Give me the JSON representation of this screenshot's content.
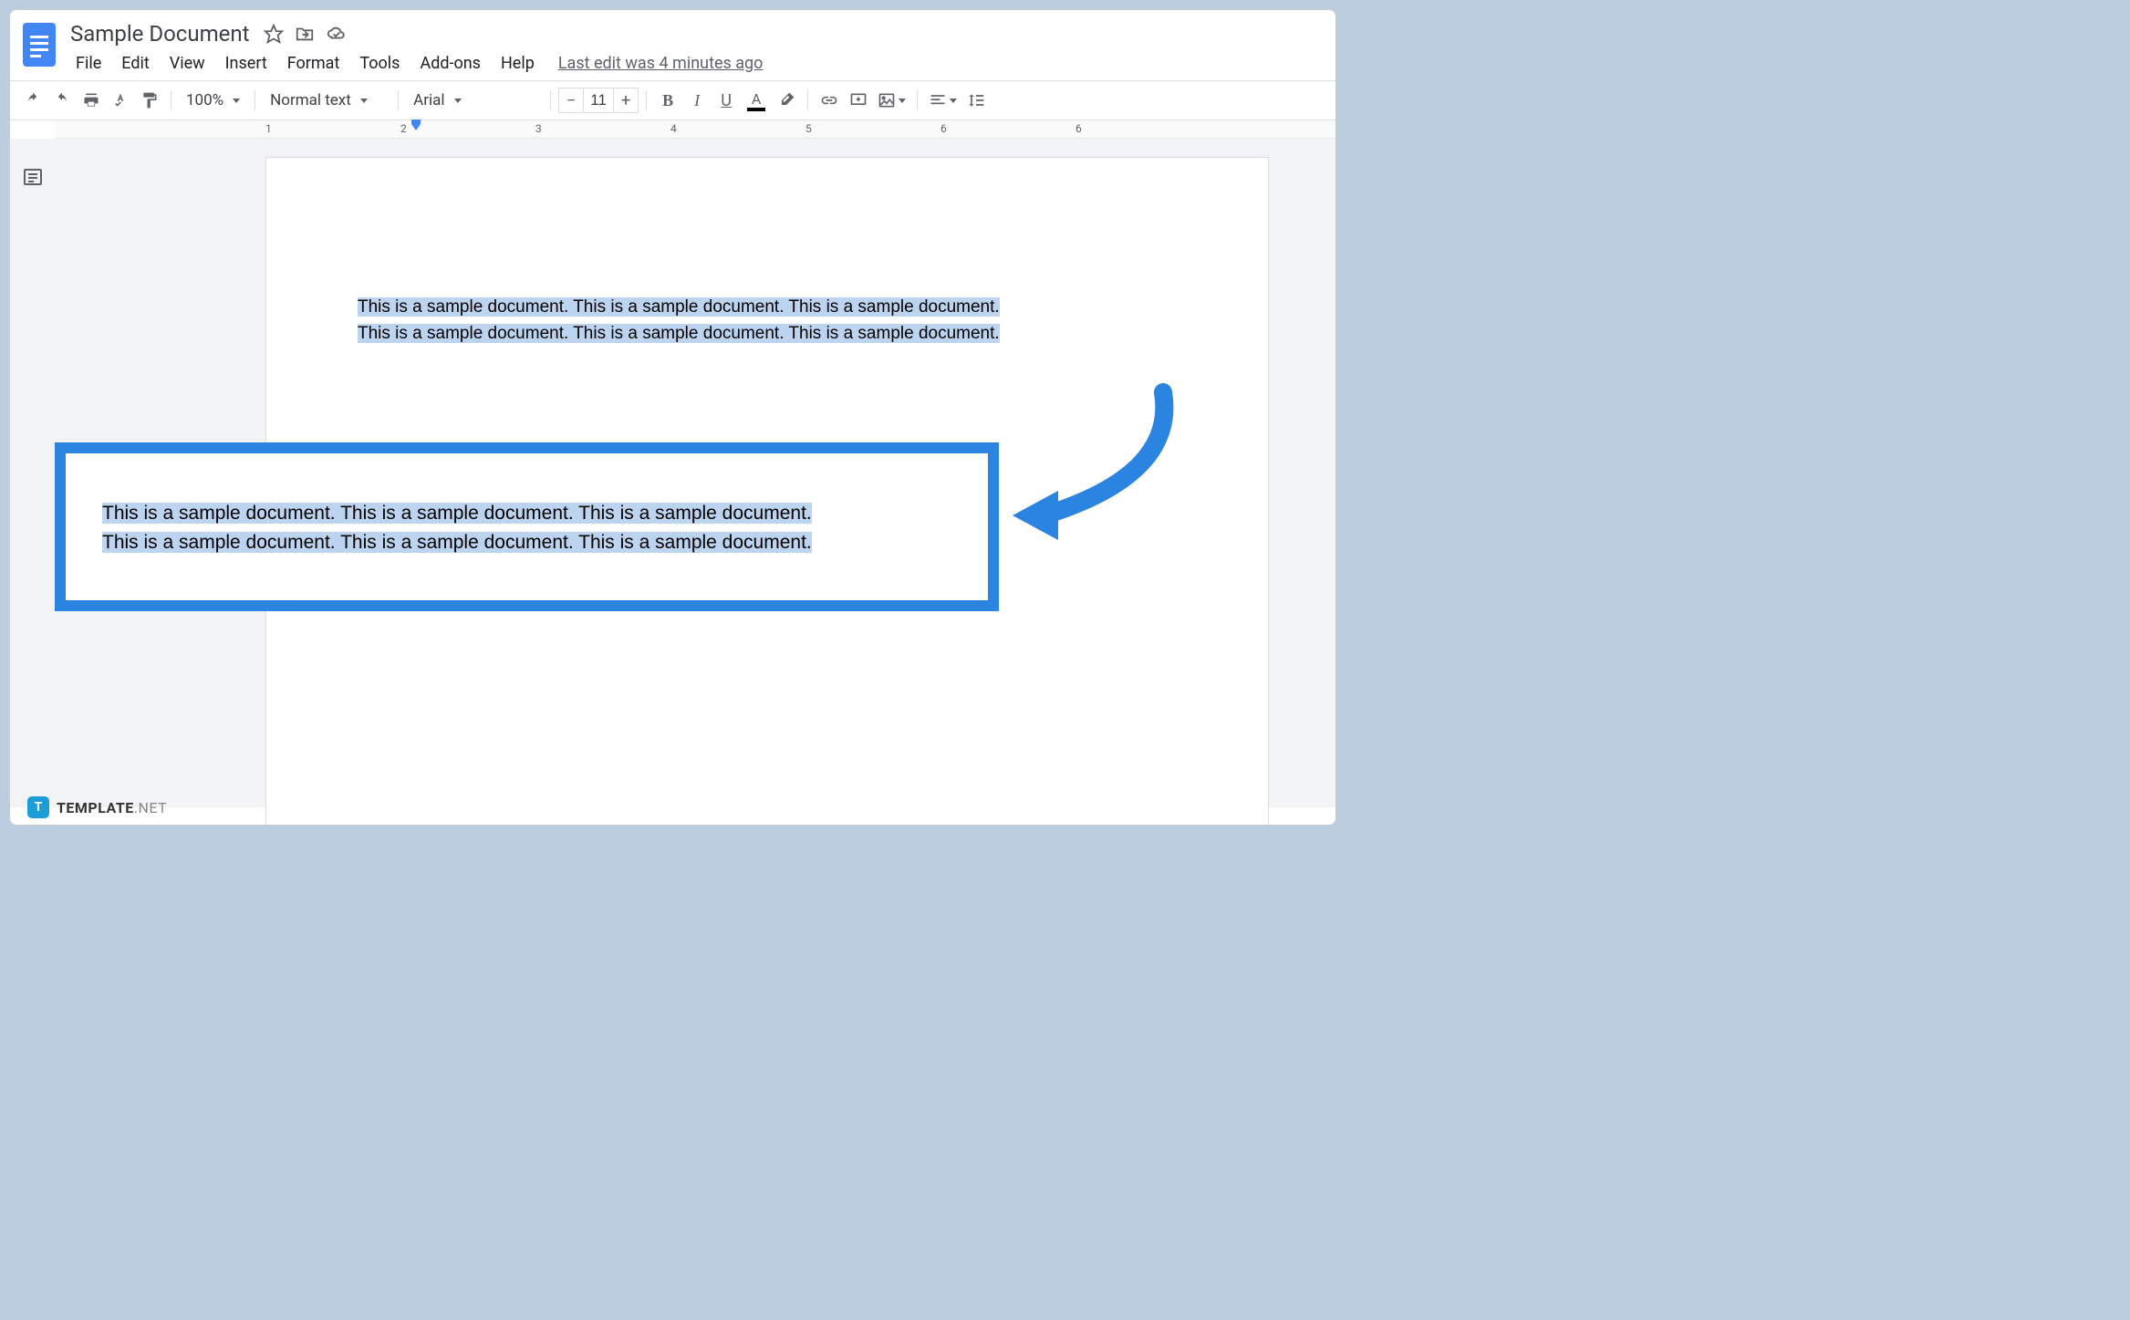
{
  "header": {
    "title": "Sample Document",
    "last_edit": "Last edit was 4 minutes ago"
  },
  "menubar": {
    "items": [
      "File",
      "Edit",
      "View",
      "Insert",
      "Format",
      "Tools",
      "Add-ons",
      "Help"
    ]
  },
  "toolbar": {
    "zoom": "100%",
    "style": "Normal text",
    "font": "Arial",
    "font_size": "11"
  },
  "ruler": {
    "marks": [
      "1",
      "2",
      "3",
      "4",
      "5",
      "6"
    ]
  },
  "document": {
    "paragraph_line1": "This is a sample document. This is a sample document. This is a sample document.",
    "paragraph_line2": "This is a sample document. This is a sample document. This is a sample document."
  },
  "callout": {
    "line1": "This is a sample document. This is a sample document. This is a sample document.",
    "line2": "This is a sample document. This is a sample document. This is a sample document."
  },
  "watermark": {
    "brand": "TEMPLATE",
    "suffix": ".NET"
  }
}
